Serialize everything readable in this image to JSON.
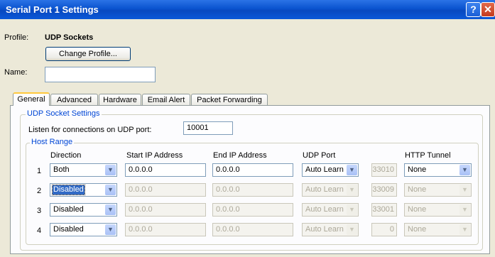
{
  "window": {
    "title": "Serial Port 1 Settings",
    "help_label": "?",
    "close_label": "✕"
  },
  "profile": {
    "label": "Profile:",
    "value": "UDP Sockets",
    "change_button": "Change Profile..."
  },
  "name": {
    "label": "Name:",
    "value": ""
  },
  "tabs": [
    {
      "label": "General",
      "active": true
    },
    {
      "label": "Advanced",
      "active": false
    },
    {
      "label": "Hardware",
      "active": false
    },
    {
      "label": "Email Alert",
      "active": false
    },
    {
      "label": "Packet Forwarding",
      "active": false
    }
  ],
  "udp_settings": {
    "title": "UDP Socket Settings",
    "listen_label": "Listen for connections on UDP port:",
    "listen_port": "10001"
  },
  "host_range": {
    "title": "Host Range",
    "headers": {
      "direction": "Direction",
      "start_ip": "Start IP Address",
      "end_ip": "End IP Address",
      "udp_port": "UDP Port",
      "http_tunnel": "HTTP Tunnel"
    },
    "rows": [
      {
        "index": "1",
        "direction": "Both",
        "start_ip": "0.0.0.0",
        "end_ip": "0.0.0.0",
        "udp_port_mode": "Auto Learn",
        "udp_port": "33010",
        "http_tunnel": "None",
        "enabled": true
      },
      {
        "index": "2",
        "direction": "Disabled",
        "start_ip": "0.0.0.0",
        "end_ip": "0.0.0.0",
        "udp_port_mode": "Auto Learn",
        "udp_port": "33009",
        "http_tunnel": "None",
        "enabled": false
      },
      {
        "index": "3",
        "direction": "Disabled",
        "start_ip": "0.0.0.0",
        "end_ip": "0.0.0.0",
        "udp_port_mode": "Auto Learn",
        "udp_port": "33001",
        "http_tunnel": "None",
        "enabled": false
      },
      {
        "index": "4",
        "direction": "Disabled",
        "start_ip": "0.0.0.0",
        "end_ip": "0.0.0.0",
        "udp_port_mode": "Auto Learn",
        "udp_port": "0",
        "http_tunnel": "None",
        "enabled": false
      }
    ]
  }
}
